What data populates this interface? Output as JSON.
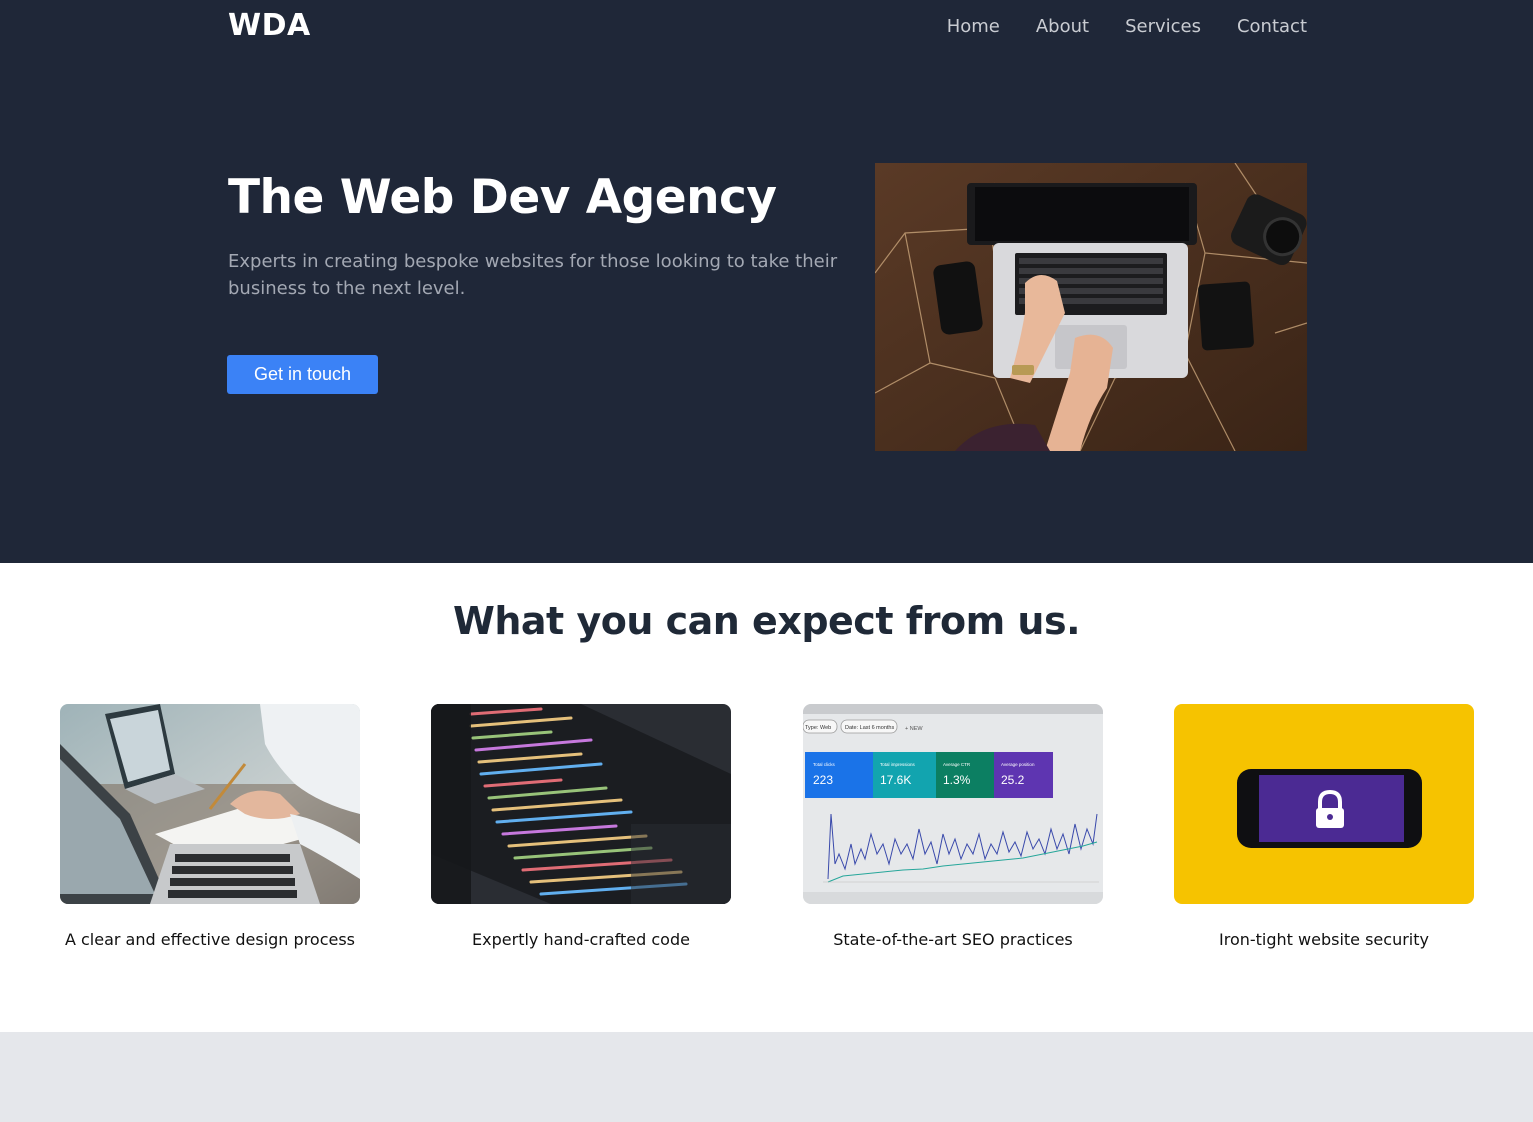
{
  "header": {
    "logo": "WDA",
    "nav": [
      "Home",
      "About",
      "Services",
      "Contact"
    ]
  },
  "hero": {
    "title": "The Web Dev Agency",
    "subtitle": "Experts in creating bespoke websites for those looking to take their business to the next level.",
    "cta_label": "Get in touch"
  },
  "features": {
    "title": "What you can expect from us.",
    "cards": [
      {
        "label": "A clear and effective design process",
        "icon": "design-meeting-photo"
      },
      {
        "label": "Expertly hand-crafted code",
        "icon": "code-screen-photo"
      },
      {
        "label": "State-of-the-art SEO practices",
        "icon": "analytics-dashboard-photo"
      },
      {
        "label": "Iron-tight website security",
        "icon": "phone-lock-photo"
      }
    ],
    "seo_dashboard": {
      "tabs": [
        "Type: Web",
        "Date: Last 6 months",
        "+ NEW"
      ],
      "metrics": [
        {
          "label": "Total clicks",
          "value": "223"
        },
        {
          "label": "Total impressions",
          "value": "17.6K"
        },
        {
          "label": "Average CTR",
          "value": "1.3%"
        },
        {
          "label": "Average position",
          "value": "25.2"
        }
      ]
    }
  },
  "colors": {
    "hero_bg": "#1f2738",
    "accent": "#3b82f6",
    "bottom_band": "#e5e7eb"
  }
}
